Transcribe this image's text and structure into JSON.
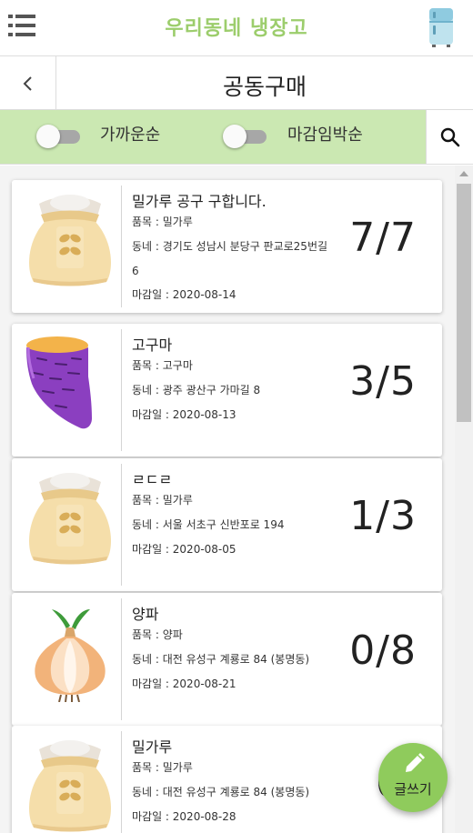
{
  "header": {
    "app_title": "우리동네 냉장고",
    "menu_icon": "hamburger-menu-icon",
    "logo_icon": "fridge-icon"
  },
  "subheader": {
    "back_icon": "chevron-left-icon",
    "page_title": "공동구매"
  },
  "filters": {
    "toggle_1_label": "가까운순",
    "toggle_2_label": "마감임박순",
    "search_icon": "search-icon"
  },
  "posts": [
    {
      "title": "밀가루 공구 구합니다.",
      "item": "품목 : 밀가루",
      "area_line1": "동네 : 경기도 성남시 분당구 판교로25번길",
      "area_line2": "6",
      "deadline": "마감일 : 2020-08-14",
      "count": "7/7",
      "image": "flour-sack"
    },
    {
      "title": "고구마",
      "item": "품목 : 고구마",
      "area_line1": "동네 : 광주 광산구 가마길 8",
      "area_line2": "",
      "deadline": "마감일 : 2020-08-13",
      "count": "3/5",
      "image": "sweet-potato"
    },
    {
      "title": "ㄹㄷㄹ",
      "item": "품목 : 밀가루",
      "area_line1": "동네 : 서울 서초구 신반포로 194",
      "area_line2": "",
      "deadline": "마감일 : 2020-08-05",
      "count": "1/3",
      "image": "flour-sack"
    },
    {
      "title": "양파",
      "item": "품목 : 양파",
      "area_line1": "동네 : 대전 유성구 계룡로 84 (봉명동)",
      "area_line2": "",
      "deadline": "마감일 : 2020-08-21",
      "count": "0/8",
      "image": "onion"
    },
    {
      "title": "밀가루",
      "item": "품목 : 밀가루",
      "area_line1": "동네 : 대전 유성구 계룡로 84 (봉명동)",
      "area_line2": "",
      "deadline": "마감일 : 2020-08-28",
      "count": "0/",
      "image": "flour-sack"
    }
  ],
  "fab": {
    "label": "글쓰기",
    "icon": "pencil-icon"
  },
  "colors": {
    "brand_green": "#9ccd6c",
    "filter_bar": "#cbe8b2",
    "fab": "#8fcb5c"
  }
}
